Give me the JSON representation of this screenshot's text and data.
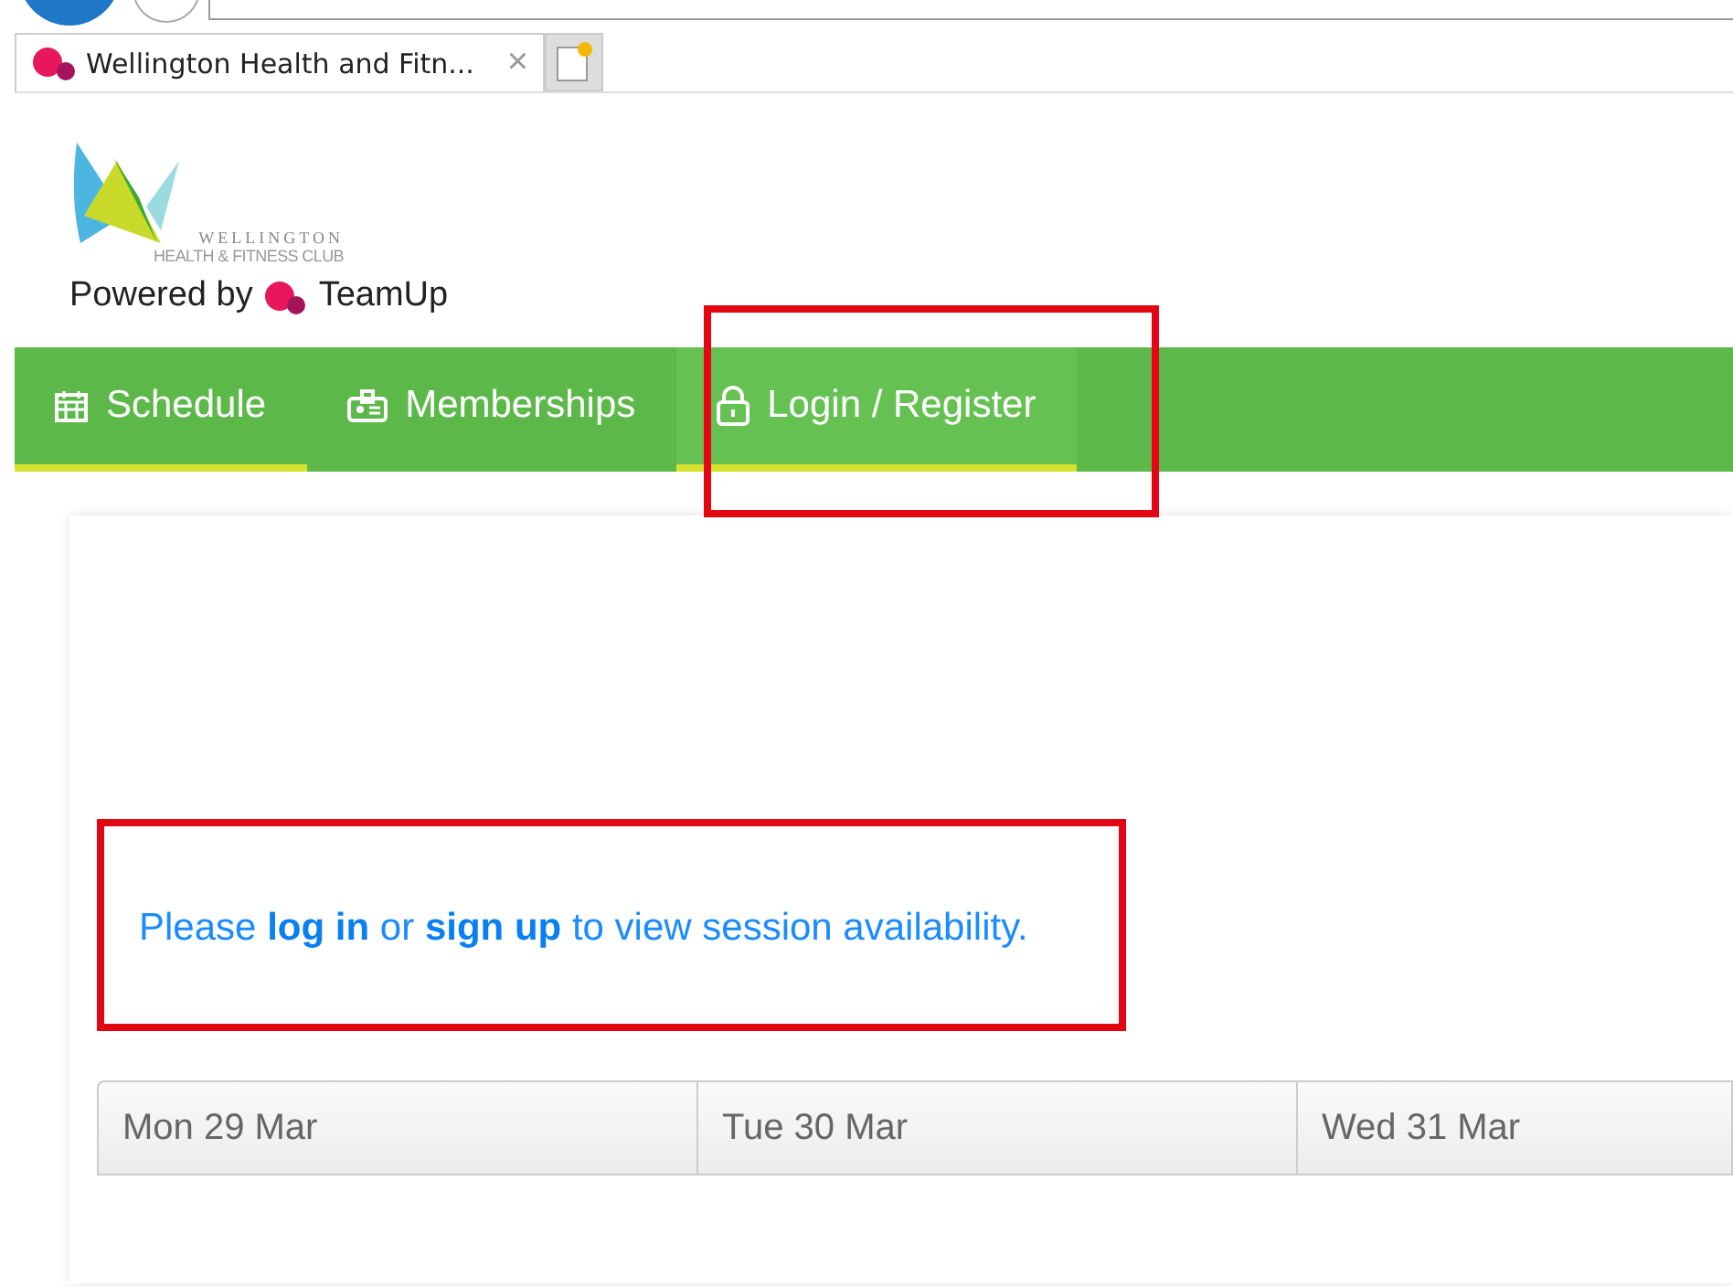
{
  "browser": {
    "tab": {
      "title": "Wellington Health and Fitn...",
      "close": "×"
    }
  },
  "header": {
    "logo": {
      "line1": "WELLINGTON",
      "line2": "HEALTH & FITNESS CLUB"
    },
    "powered_by": "Powered by",
    "brand": "TeamUp"
  },
  "nav": [
    {
      "kind": "calendar",
      "label": "Schedule",
      "selected": true,
      "highlighted": false
    },
    {
      "kind": "badge",
      "label": "Memberships",
      "selected": false,
      "highlighted": false
    },
    {
      "kind": "lock",
      "label": "Login / Register",
      "selected": false,
      "highlighted": true
    }
  ],
  "notice": {
    "before": "Please",
    "login": "log in",
    "middle": "or",
    "signup": "sign up",
    "after": "to view session availability."
  },
  "days": [
    "Mon 29 Mar",
    "Tue 30 Mar",
    "Wed 31 Mar"
  ],
  "annotations": [
    {
      "kind": "box"
    },
    {
      "kind": "box"
    }
  ]
}
